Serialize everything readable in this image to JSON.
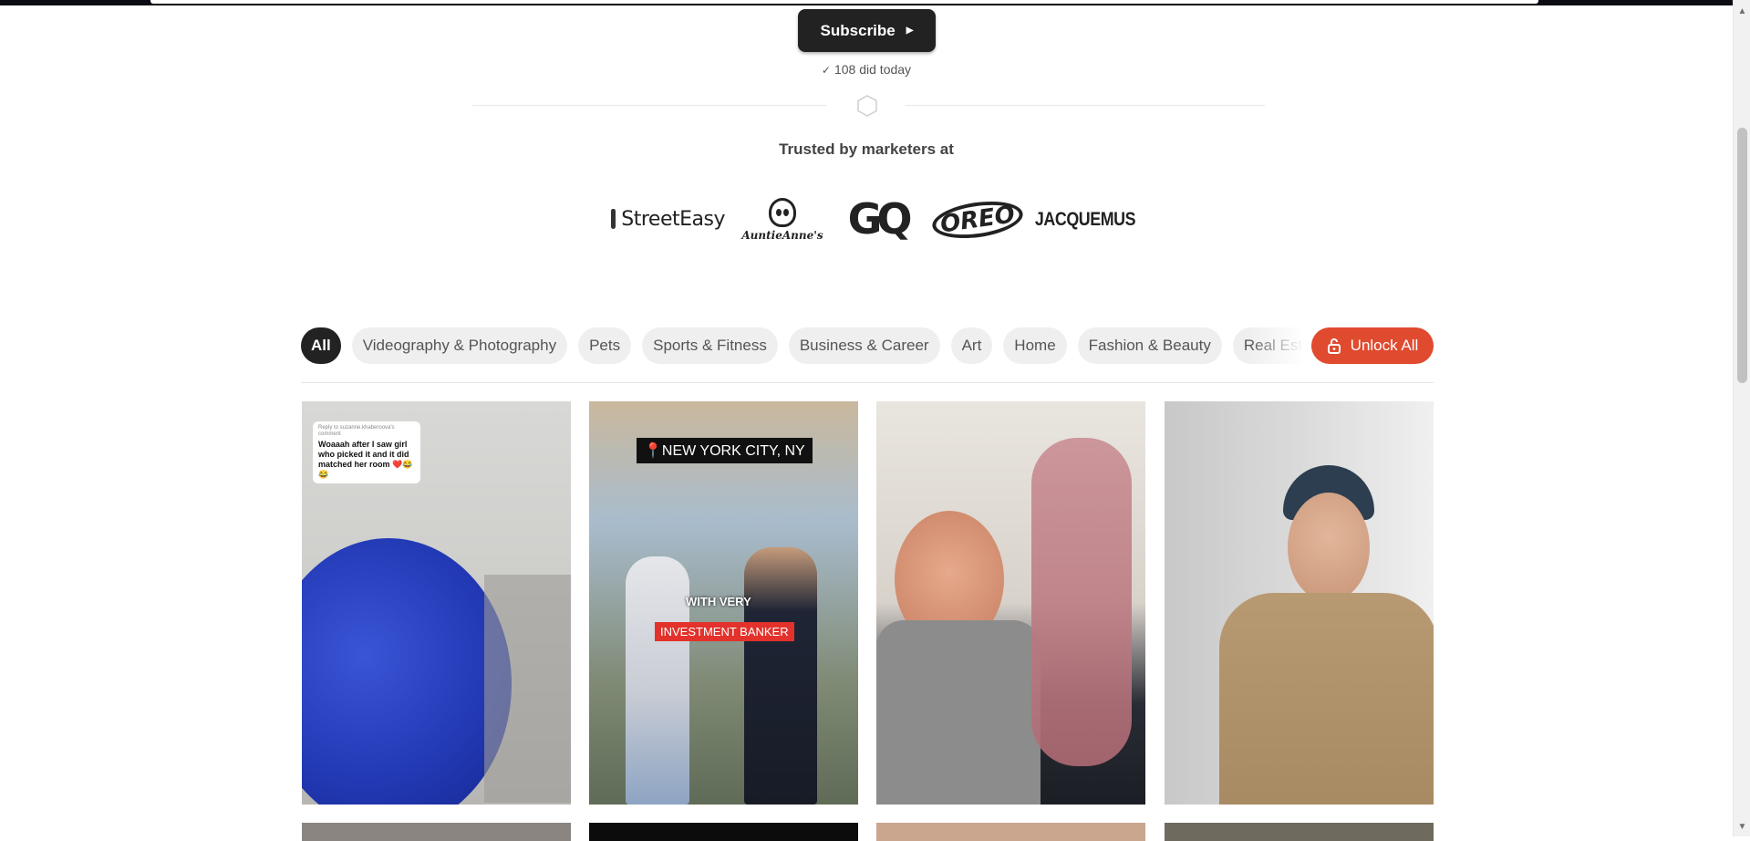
{
  "hero": {
    "subscribe_label": "Subscribe",
    "did_today": "108 did today",
    "trusted_label": "Trusted by marketers at"
  },
  "logos": [
    {
      "name": "StreetEasy",
      "text": "StreetEasy"
    },
    {
      "name": "Auntie Anne's",
      "text": "AuntieAnne's"
    },
    {
      "name": "GQ",
      "text": "GQ"
    },
    {
      "name": "OREO",
      "text": "OREO"
    },
    {
      "name": "JACQUEMUS",
      "text": "JACQUEMUS"
    }
  ],
  "filters": {
    "pills": [
      {
        "label": "All",
        "active": true
      },
      {
        "label": "Videography & Photography"
      },
      {
        "label": "Pets"
      },
      {
        "label": "Sports & Fitness"
      },
      {
        "label": "Business & Career"
      },
      {
        "label": "Art"
      },
      {
        "label": "Home"
      },
      {
        "label": "Fashion & Beauty"
      },
      {
        "label": "Real Estate"
      }
    ],
    "unlock_label": "Unlock All"
  },
  "videos": [
    {
      "reply_text": "Reply to suzanne.khaberoova's comment",
      "caption": "Woaaah after I saw girl who picked it and it did matched her room ❤️😂😂"
    },
    {
      "location_label": "📍NEW YORK CITY, NY",
      "overlay_text": "WITH VERY",
      "tag_text": "INVESTMENT BANKER"
    },
    {},
    {}
  ],
  "colors": {
    "accent": "#e04a2f",
    "dark": "#222222",
    "pill_bg": "#efefef"
  }
}
